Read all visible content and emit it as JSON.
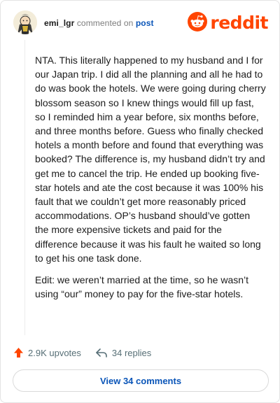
{
  "header": {
    "username": "emi_lgr",
    "action_text": "commented on",
    "target": "post",
    "brand": "reddit"
  },
  "comment": {
    "paragraphs": [
      "NTA. This literally happened to my husband and I for our Japan trip. I did all the planning and all he had to do was book the hotels. We were going during cherry blossom season so I knew things would fill up fast, so I reminded him a year before, six months before, and three months before. Guess who finally checked hotels a month before and found that everything was booked? The difference is, my husband didn’t try and get me to cancel the trip. He ended up booking five-star hotels and ate the cost because it was 100% his fault that we couldn’t get more reasonably priced accommodations. OP’s husband should’ve gotten the more expensive tickets and paid for the difference because it was his fault he waited so long to get his one task done.",
      "Edit: we weren’t married at the time, so he wasn’t using “our” money to pay for the five-star hotels."
    ]
  },
  "actions": {
    "upvotes": "2.9K upvotes",
    "replies": "34 replies",
    "view_comments": "View 34 comments"
  },
  "colors": {
    "brand": "#ff4500",
    "link": "#0a55b8",
    "muted": "#576f76"
  },
  "icons": {
    "avatar": "avatar",
    "logo": "reddit-snoo-icon",
    "upvote": "upvote-arrow-icon",
    "reply": "reply-arrow-icon"
  }
}
